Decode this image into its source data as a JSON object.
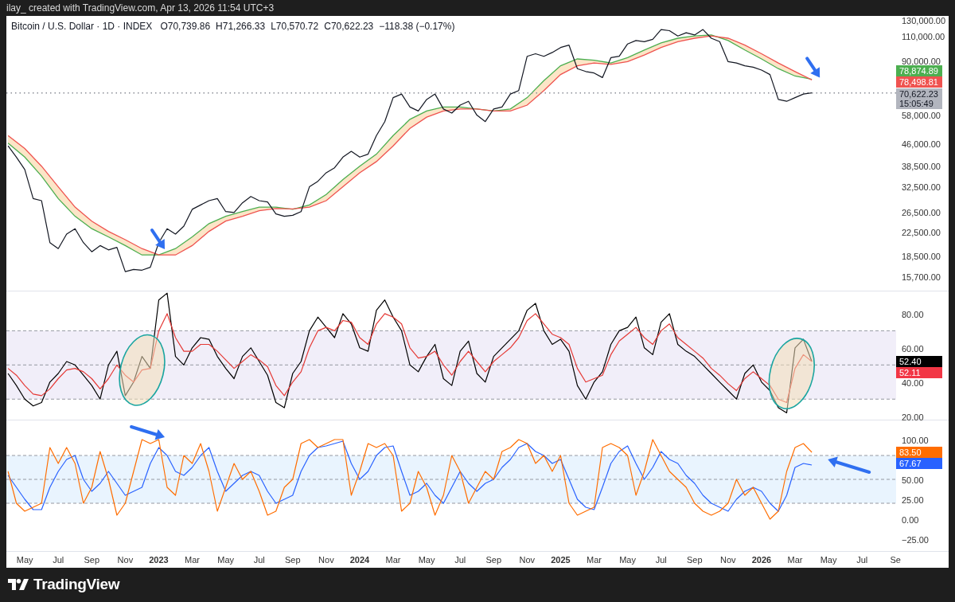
{
  "header": {
    "text": "ilay_ created with TradingView.com, Apr 13, 2026 11:54 UTC+3"
  },
  "legend": {
    "symbol": "Bitcoin / U.S. Dollar · 1D · INDEX",
    "values": [
      "O70,739.86",
      "H71,266.33",
      "L70,570.72",
      "C70,622.23",
      "−118.38 (−0.17%)"
    ]
  },
  "panels": [
    {
      "kind": "price",
      "axis_labels": [
        "130,000.00",
        "110,000.00",
        "90,000.00",
        "58,000.00",
        "46,000.00",
        "38,500.00",
        "32,500.00",
        "26,500.00",
        "22,500.00",
        "18,500.00",
        "15,700.00"
      ],
      "drawings": [
        {
          "kind": "arrow"
        },
        {
          "kind": "arrow"
        }
      ],
      "value_labels": [
        {
          "text": "78,874.89",
          "color": "#4caf50"
        },
        {
          "text": "78,498.81",
          "color": "#ef5350"
        }
      ],
      "last_price": {
        "text": "70,622.23",
        "countdown": "15:05:49"
      }
    },
    {
      "kind": "rsi",
      "axis_labels": [
        "80.00",
        "60.00",
        "40.00",
        "20.00"
      ],
      "drawings": [
        {
          "kind": "ellipse"
        },
        {
          "kind": "ellipse"
        }
      ],
      "value_labels": [
        {
          "text": "52.40",
          "color": "#000000"
        },
        {
          "text": "52.11",
          "color": "#f23645"
        }
      ]
    },
    {
      "kind": "stoch",
      "axis_labels": [
        "100.00",
        "50.00",
        "25.00",
        "0.00",
        "−25.00"
      ],
      "drawings": [
        {
          "kind": "arrow"
        },
        {
          "kind": "arrow"
        }
      ],
      "value_labels": [
        {
          "text": "83.50",
          "color": "#ff6d00"
        },
        {
          "text": "67.67",
          "color": "#2962ff"
        }
      ]
    }
  ],
  "time_axis": [
    {
      "label": "May",
      "kind": "month"
    },
    {
      "label": "Jul",
      "kind": "month"
    },
    {
      "label": "Sep",
      "kind": "month"
    },
    {
      "label": "Nov",
      "kind": "month"
    },
    {
      "label": "2023",
      "kind": "year"
    },
    {
      "label": "Mar",
      "kind": "month"
    },
    {
      "label": "May",
      "kind": "month"
    },
    {
      "label": "Jul",
      "kind": "month"
    },
    {
      "label": "Sep",
      "kind": "month"
    },
    {
      "label": "Nov",
      "kind": "month"
    },
    {
      "label": "2024",
      "kind": "year"
    },
    {
      "label": "Mar",
      "kind": "month"
    },
    {
      "label": "May",
      "kind": "month"
    },
    {
      "label": "Jul",
      "kind": "month"
    },
    {
      "label": "Sep",
      "kind": "month"
    },
    {
      "label": "Nov",
      "kind": "month"
    },
    {
      "label": "2025",
      "kind": "year"
    },
    {
      "label": "Mar",
      "kind": "month"
    },
    {
      "label": "May",
      "kind": "month"
    },
    {
      "label": "Jul",
      "kind": "month"
    },
    {
      "label": "Sep",
      "kind": "month"
    },
    {
      "label": "Nov",
      "kind": "month"
    },
    {
      "label": "2026",
      "kind": "year"
    },
    {
      "label": "Mar",
      "kind": "month"
    },
    {
      "label": "May",
      "kind": "month"
    },
    {
      "label": "Jul",
      "kind": "month"
    },
    {
      "label": "Se",
      "kind": "month"
    }
  ],
  "brand": {
    "name": "TradingView"
  }
}
